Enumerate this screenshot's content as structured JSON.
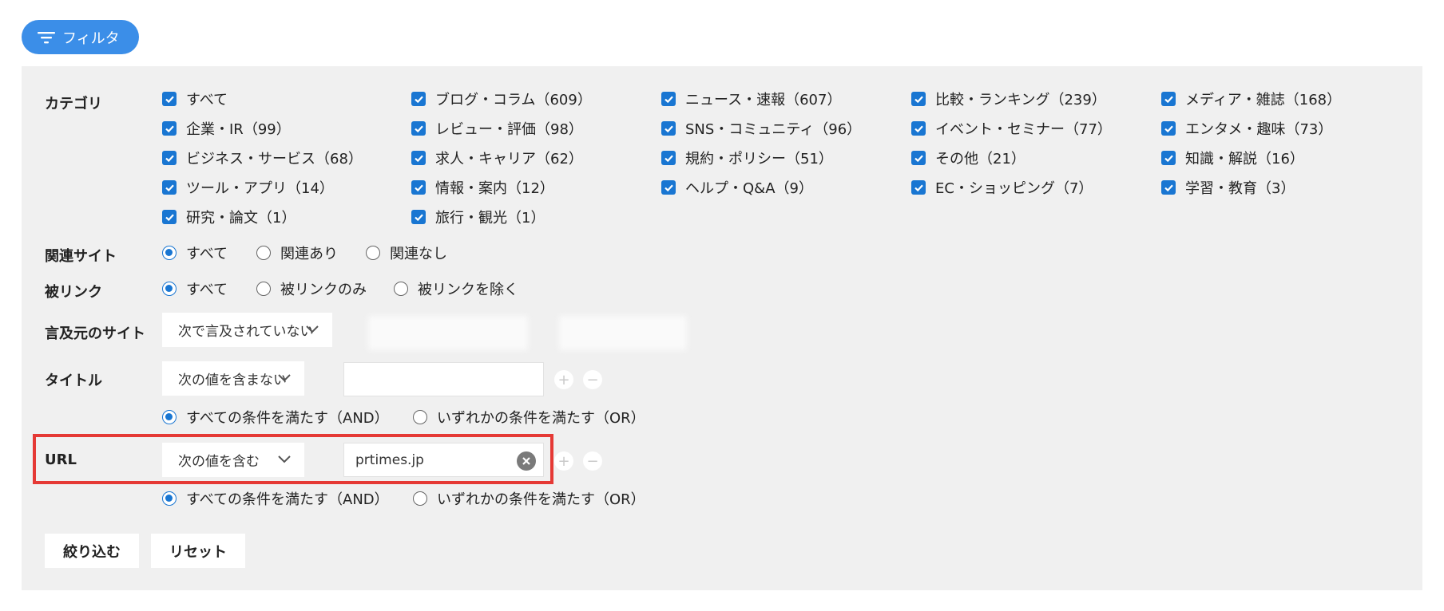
{
  "filter_button": {
    "label": "フィルタ",
    "icon": "filter-icon"
  },
  "colors": {
    "accent": "#1976d2",
    "button": "#3b8ee8",
    "highlight": "#e53935",
    "panel": "#f0f0f0"
  },
  "category": {
    "label": "カテゴリ",
    "items": [
      "すべて",
      "ブログ・コラム（609）",
      "ニュース・速報（607）",
      "比較・ランキング（239）",
      "メディア・雑誌（168）",
      "企業・IR（99）",
      "レビュー・評価（98）",
      "SNS・コミュニティ（96）",
      "イベント・セミナー（77）",
      "エンタメ・趣味（73）",
      "ビジネス・サービス（68）",
      "求人・キャリア（62）",
      "規約・ポリシー（51）",
      "その他（21）",
      "知識・解説（16）",
      "ツール・アプリ（14）",
      "情報・案内（12）",
      "ヘルプ・Q&A（9）",
      "EC・ショッピング（7）",
      "学習・教育（3）",
      "研究・論文（1）",
      "旅行・観光（1）"
    ]
  },
  "related_site": {
    "label": "関連サイト",
    "options": [
      "すべて",
      "関連あり",
      "関連なし"
    ],
    "selected": 0
  },
  "backlink": {
    "label": "被リンク",
    "options": [
      "すべて",
      "被リンクのみ",
      "被リンクを除く"
    ],
    "selected": 0
  },
  "source_site": {
    "label": "言及元のサイト",
    "select_value": "次で言及されていない"
  },
  "title_filter": {
    "label": "タイトル",
    "select_value": "次の値を含まない",
    "input_value": "",
    "logic_options": [
      "すべての条件を満たす（AND）",
      "いずれかの条件を満たす（OR）"
    ],
    "logic_selected": 0
  },
  "url_filter": {
    "label": "URL",
    "select_value": "次の値を含む",
    "input_value": "prtimes.jp",
    "logic_options": [
      "すべての条件を満たす（AND）",
      "いずれかの条件を満たす（OR）"
    ],
    "logic_selected": 0
  },
  "plus_symbol": "+",
  "minus_symbol": "−",
  "actions": {
    "apply": "絞り込む",
    "reset": "リセット"
  }
}
